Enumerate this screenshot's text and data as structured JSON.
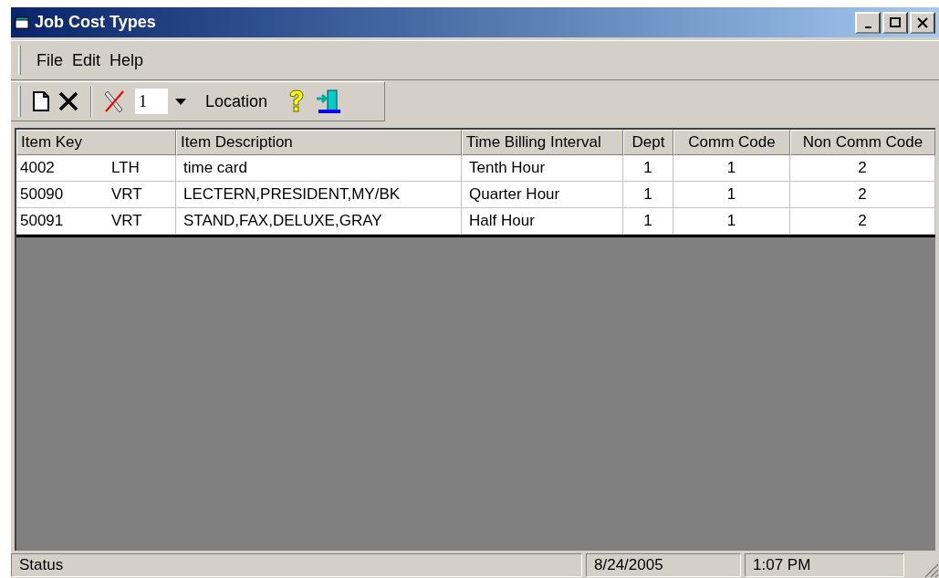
{
  "window": {
    "title": "Job Cost Types"
  },
  "menu": [
    "File",
    "Edit",
    "Help"
  ],
  "toolbar": {
    "location_value": "1",
    "location_label": "Location"
  },
  "table": {
    "columns": [
      "Item Key",
      "Item Description",
      "Time Billing Interval",
      "Dept",
      "Comm Code",
      "Non Comm Code"
    ],
    "rows": [
      {
        "key": "4002",
        "code": "LTH",
        "description": "time card",
        "interval": "Tenth Hour",
        "dept": "1",
        "comm": "1",
        "non_comm": "2"
      },
      {
        "key": "50090",
        "code": "VRT",
        "description": "LECTERN,PRESIDENT,MY/BK",
        "interval": "Quarter Hour",
        "dept": "1",
        "comm": "1",
        "non_comm": "2"
      },
      {
        "key": "50091",
        "code": "VRT",
        "description": "STAND,FAX,DELUXE,GRAY",
        "interval": "Half Hour",
        "dept": "1",
        "comm": "1",
        "non_comm": "2"
      }
    ]
  },
  "status_bar": {
    "status": "Status",
    "date": "8/24/2005",
    "time": "1:07 PM"
  }
}
